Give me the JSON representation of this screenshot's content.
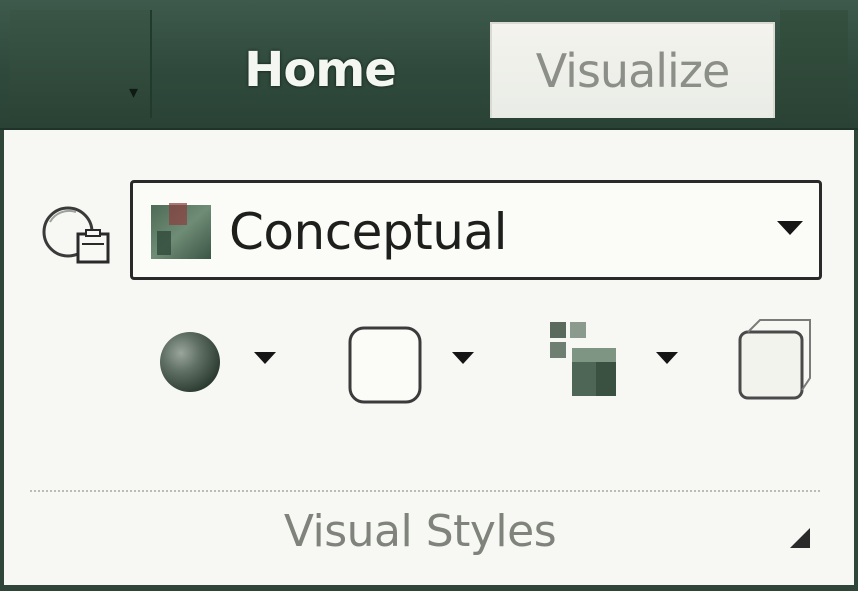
{
  "ribbon": {
    "tabs": [
      {
        "label": "Home",
        "active": false
      },
      {
        "label": "Visualize",
        "active": true
      }
    ]
  },
  "visual_styles": {
    "selected_style": "Conceptual",
    "panel_title": "Visual Styles",
    "icons": {
      "style_manager": "visual-style-manager-icon",
      "shading": "shaded-sphere-icon",
      "edges": "edge-style-box-icon",
      "shadows": "shadow-cubes-icon",
      "xray": "xray-cube-icon"
    }
  },
  "colors": {
    "ribbon_bg": "#2f4a3c",
    "panel_bg": "#f7f8f3",
    "tab_active_bg": "#f0f0eb",
    "text_dark": "#1d1f1c",
    "text_muted": "#7f837c"
  }
}
